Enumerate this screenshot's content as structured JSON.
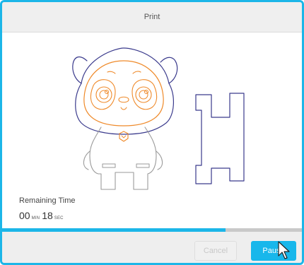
{
  "dialog": {
    "title": "Print",
    "remaining": {
      "label": "Remaining Time",
      "minutes": "00",
      "min_unit": "MIN",
      "seconds": "18",
      "sec_unit": "SEC"
    },
    "progress_fraction": 0.745,
    "buttons": {
      "cancel": "Cancel",
      "pause": "Pause"
    }
  },
  "colors": {
    "accent": "#1cb6e8",
    "model_outline_blue": "#3a3a8c",
    "model_outline_orange": "#ef8a2a",
    "model_outline_gray": "#9a9a9a"
  }
}
